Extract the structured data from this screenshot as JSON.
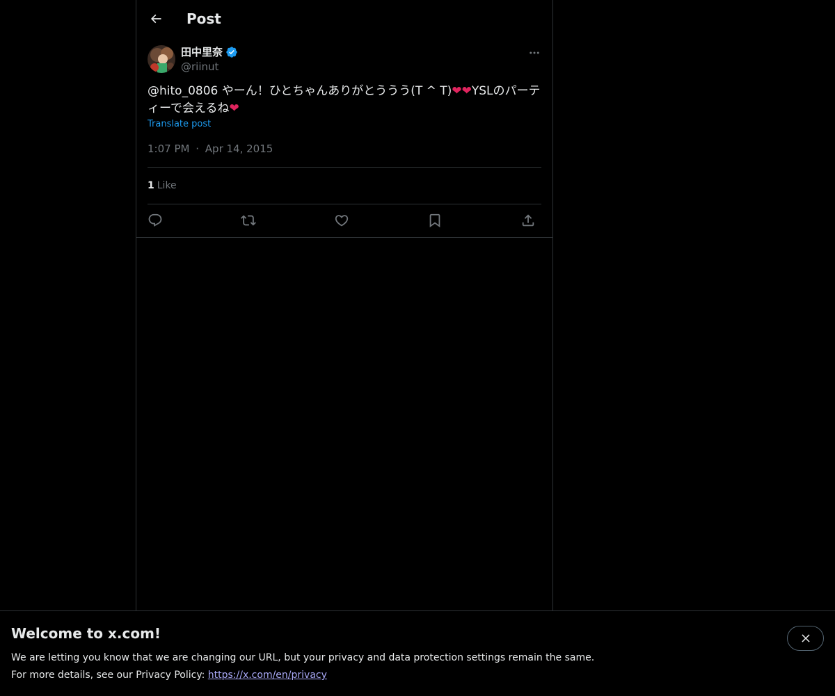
{
  "header": {
    "title": "Post"
  },
  "post": {
    "display_name": "田中里奈",
    "handle": "@riinut",
    "text_parts": {
      "a": "@hito_0806 やーん！ひとちゃんありがとううう(T ^ T)",
      "heart": "❤",
      "b": "YSLのパーティーで会えるね"
    },
    "translate_label": "Translate post",
    "time": "1:07 PM",
    "separator": "·",
    "date": "Apr 14, 2015",
    "likes_count": "1",
    "likes_label": "Like"
  },
  "icons": {
    "back": "arrow-left-icon",
    "more": "more-horizontal-icon",
    "verified": "verified-badge-icon",
    "reply": "reply-icon",
    "repost": "repost-icon",
    "like": "heart-icon",
    "bookmark": "bookmark-icon",
    "share": "share-icon",
    "close": "close-icon"
  },
  "colors": {
    "accent": "#1d9bf0",
    "heart": "#e0245e",
    "muted": "#71767b",
    "link": "#a9a9f7"
  },
  "banner": {
    "title": "Welcome to x.com!",
    "line1": "We are letting you know that we are changing our URL, but your privacy and data protection settings remain the same.",
    "line2_prefix": "For more details, see our Privacy Policy: ",
    "link": "https://x.com/en/privacy"
  }
}
